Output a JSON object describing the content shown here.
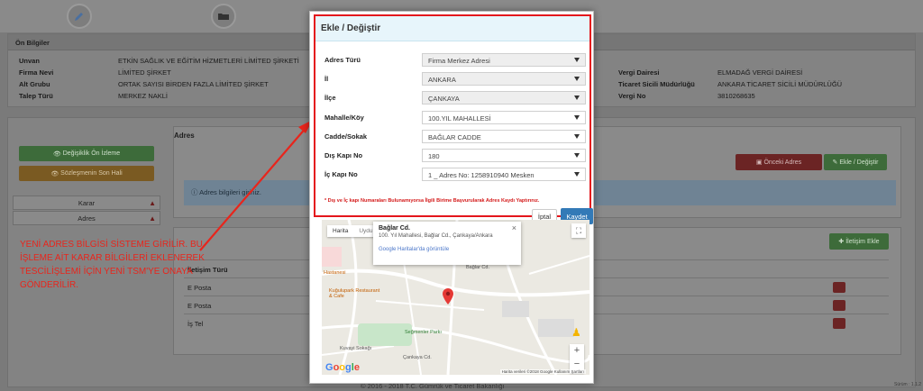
{
  "info": {
    "heading": "Ön Bilgiler",
    "rows": [
      {
        "label": "Unvan",
        "value": "ETKİN SAĞLIK VE EĞİTİM HİZMETLERİ LİMİTED ŞİRKETİ"
      },
      {
        "label": "Firma Nevi",
        "value": "LİMİTED ŞİRKET"
      },
      {
        "label": "Alt Grubu",
        "value": "ORTAK SAYISI BİRDEN FAZLA LİMİTED ŞİRKET"
      },
      {
        "label": "Talep Türü",
        "value": "MERKEZ NAKLİ"
      }
    ],
    "right_rows": [
      {
        "label": "Vergi Dairesi",
        "value": "ELMADAĞ VERGİ DAİRESİ"
      },
      {
        "label": "Ticaret Sicili Müdürlüğü",
        "value": "ANKARA TİCARET SİCİLİ MÜDÜRLÜĞÜ"
      },
      {
        "label": "Vergi No",
        "value": "3810268635"
      }
    ]
  },
  "sidebar": {
    "preview_button": "Değişiklik Ön İzleme",
    "contract_button": "Sözleşmenin Son Hali",
    "items": [
      {
        "label": "Karar"
      },
      {
        "label": "Adres"
      }
    ]
  },
  "address_section": {
    "heading": "Adres",
    "prev_button": "Önceki Adres",
    "edit_button": "Ekle / Değiştir",
    "alert": "Adres bilgileri giriniz."
  },
  "contact_section": {
    "add_button": "İletişim Ekle",
    "column": "İletişim Türü",
    "rows": [
      "E Posta",
      "E Posta",
      "İş Tel"
    ]
  },
  "annotation": "YENİ ADRES BİLGİSİ SİSTEME GİRİLİR. BU İŞLEME AİT KARAR BİLGİLERİ EKLENEREK TESCİLİŞLEMİ İÇİN YENİ TSM'YE ONAYA GÖNDERİLİR.",
  "footer": "© 2016 - 2018",
  "footer_org": "T.C. Gümrük ve Ticaret Bakanlığı",
  "version": "Sürüm : 1.1.2",
  "modal": {
    "title": "Ekle / Değiştir",
    "fields": [
      {
        "label": "Adres Türü",
        "value": "Firma Merkez Adresi",
        "disabled": true
      },
      {
        "label": "İl",
        "value": "ANKARA",
        "disabled": true
      },
      {
        "label": "İlçe",
        "value": "ÇANKAYA",
        "disabled": true
      },
      {
        "label": "Mahalle/Köy",
        "value": "100.YIL MAHALLESİ",
        "disabled": false
      },
      {
        "label": "Cadde/Sokak",
        "value": "BAĞLAR CADDE",
        "disabled": false
      },
      {
        "label": "Dış Kapı No",
        "value": "180",
        "disabled": false
      },
      {
        "label": "İç Kapı No",
        "value": "1 _ Adres No: 1258910940 Mesken",
        "disabled": false
      }
    ],
    "note": "* Dış ve İç kapı Numaraları Bulunamıyorsa İlgili Birime Başvurularak Adres Kaydı Yaptırınız.",
    "cancel": "İptal",
    "save": "Kaydet"
  },
  "map": {
    "tab_map": "Harita",
    "tab_sat": "Uydu",
    "info_title": "Bağlar Cd.",
    "info_address": "100. Yıl Mahallesi, Bağlar Cd., Çankaya/Ankara",
    "info_link": "Google Haritalar'da görüntüle",
    "attribution": "Harita verileri ©2018 Google   Kullanım Şartları",
    "labels": [
      "Hastanesi",
      "Kuğulupark Restaurant & Cafe",
      "Seğmenler Parkı",
      "Bağlar Cd.",
      "Kuvayi Sokağı",
      "Çankaya Cd."
    ],
    "logo": "Google"
  }
}
